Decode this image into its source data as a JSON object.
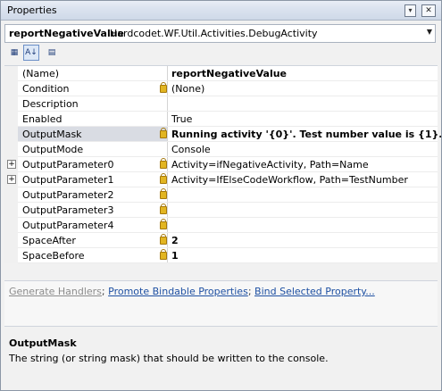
{
  "window": {
    "title": "Properties",
    "pin_glyph": "▾",
    "close_glyph": "✕"
  },
  "object_selector": {
    "name": "reportNegativeValue",
    "type": "Hardcodet.WF.Util.Activities.DebugActivity",
    "arrow_icon": "chevron-down-icon"
  },
  "toolbar": {
    "buttons": [
      {
        "icon": "categorized-icon",
        "glyph": "▦",
        "pressed": false
      },
      {
        "icon": "alphabetical-icon",
        "glyph": "A↓",
        "pressed": true
      },
      {
        "icon": "property-pages-icon",
        "glyph": "▤",
        "pressed": false
      }
    ]
  },
  "properties": [
    {
      "name": "(Name)",
      "value": "reportNegativeValue",
      "bold": true,
      "lock": false,
      "expandable": false
    },
    {
      "name": "Condition",
      "value": "(None)",
      "bold": false,
      "lock": true,
      "expandable": false
    },
    {
      "name": "Description",
      "value": "",
      "bold": false,
      "lock": false,
      "expandable": false
    },
    {
      "name": "Enabled",
      "value": "True",
      "bold": false,
      "lock": false,
      "expandable": false
    },
    {
      "name": "OutputMask",
      "value": "Running activity '{0}'. Test number value is {1}.",
      "bold": true,
      "lock": true,
      "expandable": false,
      "selected": true
    },
    {
      "name": "OutputMode",
      "value": "Console",
      "bold": false,
      "lock": false,
      "expandable": false
    },
    {
      "name": "OutputParameter0",
      "value": "Activity=ifNegativeActivity, Path=Name",
      "bold": false,
      "lock": true,
      "expandable": true
    },
    {
      "name": "OutputParameter1",
      "value": "Activity=IfElseCodeWorkflow, Path=TestNumber",
      "bold": false,
      "lock": true,
      "expandable": true
    },
    {
      "name": "OutputParameter2",
      "value": "",
      "bold": false,
      "lock": true,
      "expandable": false
    },
    {
      "name": "OutputParameter3",
      "value": "",
      "bold": false,
      "lock": true,
      "expandable": false
    },
    {
      "name": "OutputParameter4",
      "value": "",
      "bold": false,
      "lock": true,
      "expandable": false
    },
    {
      "name": "SpaceAfter",
      "value": "2",
      "bold": true,
      "lock": true,
      "expandable": false
    },
    {
      "name": "SpaceBefore",
      "value": "1",
      "bold": true,
      "lock": true,
      "expandable": false
    }
  ],
  "commands": {
    "generate_handlers": "Generate Handlers",
    "promote_bindable": "Promote Bindable Properties",
    "bind_selected": "Bind Selected Property...",
    "separator": ";"
  },
  "description": {
    "title": "OutputMask",
    "text": "The string (or string mask) that should be written to the console."
  },
  "colors": {
    "link": "#1e50a2",
    "disabled_link": "#8c8c8c",
    "selected_row": "#d9dce3",
    "lock": "#e2b521"
  }
}
